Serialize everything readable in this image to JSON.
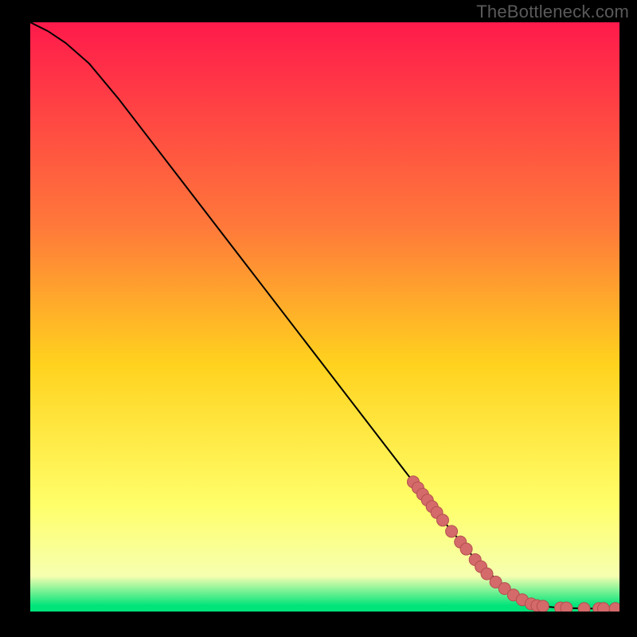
{
  "watermark": "TheBottleneck.com",
  "colors": {
    "background": "#000000",
    "gradient_top": "#ff1a4b",
    "gradient_mid_upper": "#ff7a3a",
    "gradient_mid": "#ffd21e",
    "gradient_mid_lower": "#ffff6a",
    "gradient_low": "#f6ffb0",
    "gradient_base": "#00e47a",
    "curve": "#000000",
    "points_fill": "#d46a6a",
    "points_stroke": "#b44f4f"
  },
  "chart_data": {
    "type": "line",
    "xlabel": "",
    "ylabel": "",
    "xlim": [
      0,
      100
    ],
    "ylim": [
      0,
      100
    ],
    "curve": [
      {
        "x": 0,
        "y": 100
      },
      {
        "x": 3,
        "y": 98.5
      },
      {
        "x": 6,
        "y": 96.5
      },
      {
        "x": 10,
        "y": 93
      },
      {
        "x": 15,
        "y": 87
      },
      {
        "x": 20,
        "y": 80.5
      },
      {
        "x": 25,
        "y": 74
      },
      {
        "x": 30,
        "y": 67.5
      },
      {
        "x": 35,
        "y": 61
      },
      {
        "x": 40,
        "y": 54.5
      },
      {
        "x": 45,
        "y": 48
      },
      {
        "x": 50,
        "y": 41.5
      },
      {
        "x": 55,
        "y": 35
      },
      {
        "x": 60,
        "y": 28.5
      },
      {
        "x": 65,
        "y": 22
      },
      {
        "x": 70,
        "y": 15.5
      },
      {
        "x": 75,
        "y": 9.5
      },
      {
        "x": 80,
        "y": 4.5
      },
      {
        "x": 83,
        "y": 2.2
      },
      {
        "x": 86,
        "y": 1.0
      },
      {
        "x": 90,
        "y": 0.6
      },
      {
        "x": 95,
        "y": 0.5
      },
      {
        "x": 100,
        "y": 0.5
      }
    ],
    "series": [
      {
        "name": "points",
        "type": "scatter",
        "values": [
          {
            "x": 65.0,
            "y": 22.0
          },
          {
            "x": 65.8,
            "y": 21.0
          },
          {
            "x": 66.6,
            "y": 19.9
          },
          {
            "x": 67.4,
            "y": 18.9
          },
          {
            "x": 68.2,
            "y": 17.8
          },
          {
            "x": 69.0,
            "y": 16.8
          },
          {
            "x": 70.0,
            "y": 15.5
          },
          {
            "x": 71.5,
            "y": 13.6
          },
          {
            "x": 73.0,
            "y": 11.8
          },
          {
            "x": 74.0,
            "y": 10.6
          },
          {
            "x": 75.5,
            "y": 8.8
          },
          {
            "x": 76.5,
            "y": 7.6
          },
          {
            "x": 77.5,
            "y": 6.4
          },
          {
            "x": 79.0,
            "y": 5.0
          },
          {
            "x": 80.5,
            "y": 3.9
          },
          {
            "x": 82.0,
            "y": 2.8
          },
          {
            "x": 83.5,
            "y": 2.0
          },
          {
            "x": 85.0,
            "y": 1.3
          },
          {
            "x": 86.0,
            "y": 1.0
          },
          {
            "x": 87.0,
            "y": 0.9
          },
          {
            "x": 90.0,
            "y": 0.6
          },
          {
            "x": 91.0,
            "y": 0.6
          },
          {
            "x": 94.0,
            "y": 0.5
          },
          {
            "x": 96.5,
            "y": 0.5
          },
          {
            "x": 97.3,
            "y": 0.5
          },
          {
            "x": 99.3,
            "y": 0.5
          }
        ]
      }
    ]
  }
}
